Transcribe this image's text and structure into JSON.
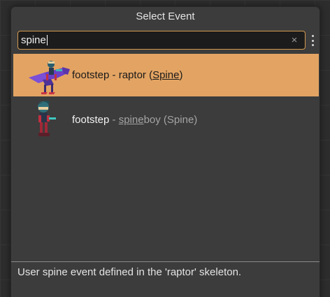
{
  "dialog": {
    "title": "Select Event"
  },
  "search": {
    "value": "spine",
    "clear_icon": "×",
    "more_icon": "more-vertical-icon"
  },
  "results": [
    {
      "event": "footstep",
      "separator": " - ",
      "skeleton_label": "raptor",
      "open_paren": " (",
      "source": "Spine",
      "close_paren": ")",
      "selected": true,
      "thumbnail_icon": "raptor-rider-icon"
    },
    {
      "event": "footstep",
      "separator": " - ",
      "skeleton_match": "spine",
      "skeleton_rest": "boy",
      "suffix": " (Spine)",
      "selected": false,
      "thumbnail_icon": "spineboy-icon"
    }
  ],
  "description": "User spine event defined in the 'raptor' skeleton.",
  "colors": {
    "selection": "#e3a463",
    "focus_border": "#d49a4f",
    "dialog_bg": "#3c3c3c",
    "input_bg": "#1c1c1c"
  }
}
